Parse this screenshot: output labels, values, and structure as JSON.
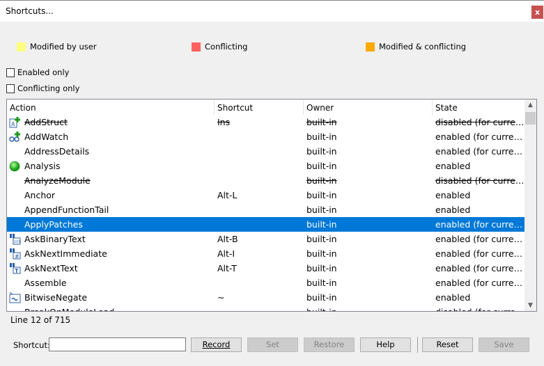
{
  "window": {
    "title": "Shortcuts...",
    "close": "x"
  },
  "legend": [
    {
      "label": "Modified by user",
      "color": "#ffff80"
    },
    {
      "label": "Conflicting",
      "color": "#ff6060"
    },
    {
      "label": "Modified & conflicting",
      "color": "#ffaa00"
    }
  ],
  "filters": {
    "enabled_only": {
      "label": "Enabled only",
      "checked": false
    },
    "conflicting_only": {
      "label": "Conflicting only",
      "checked": false
    }
  },
  "table": {
    "columns": [
      "Action",
      "Shortcut",
      "Owner",
      "State"
    ],
    "rows": [
      {
        "action": "AddStruct",
        "shortcut": "Ins",
        "owner": "built-in",
        "state": "disabled (for curren...",
        "icon": "add-struct-icon",
        "disabled": true
      },
      {
        "action": "AddWatch",
        "shortcut": "",
        "owner": "built-in",
        "state": "enabled (for current...",
        "icon": "add-watch-icon",
        "disabled": false
      },
      {
        "action": "AddressDetails",
        "shortcut": "",
        "owner": "built-in",
        "state": "enabled (for current...",
        "icon": "",
        "disabled": false
      },
      {
        "action": "Analysis",
        "shortcut": "",
        "owner": "built-in",
        "state": "enabled",
        "icon": "green-circle-icon",
        "disabled": false
      },
      {
        "action": "AnalyzeModule",
        "shortcut": "",
        "owner": "built-in",
        "state": "disabled (for curren...",
        "icon": "",
        "disabled": true
      },
      {
        "action": "Anchor",
        "shortcut": "Alt-L",
        "owner": "built-in",
        "state": "enabled",
        "icon": "",
        "disabled": false
      },
      {
        "action": "AppendFunctionTail",
        "shortcut": "",
        "owner": "built-in",
        "state": "enabled",
        "icon": "",
        "disabled": false
      },
      {
        "action": "ApplyPatches",
        "shortcut": "",
        "owner": "built-in",
        "state": "enabled (for current...",
        "icon": "",
        "disabled": false,
        "selected": true
      },
      {
        "action": "AskBinaryText",
        "shortcut": "Alt-B",
        "owner": "built-in",
        "state": "enabled (for current...",
        "icon": "binoculars-binary-icon",
        "disabled": false
      },
      {
        "action": "AskNextImmediate",
        "shortcut": "Alt-I",
        "owner": "built-in",
        "state": "enabled (for current...",
        "icon": "binoculars-hash-icon",
        "disabled": false
      },
      {
        "action": "AskNextText",
        "shortcut": "Alt-T",
        "owner": "built-in",
        "state": "enabled (for current...",
        "icon": "binoculars-text-icon",
        "disabled": false
      },
      {
        "action": "Assemble",
        "shortcut": "",
        "owner": "built-in",
        "state": "enabled (for current...",
        "icon": "",
        "disabled": false
      },
      {
        "action": "BitwiseNegate",
        "shortcut": "~",
        "owner": "built-in",
        "state": "enabled",
        "icon": "bitwise-negate-icon",
        "disabled": false
      },
      {
        "action": "BreakOnModuleLoad",
        "shortcut": "",
        "owner": "built-in",
        "state": "disabled (for curren...",
        "icon": "",
        "disabled": true
      }
    ]
  },
  "status": "Line 12 of 715",
  "footer": {
    "shortcut_label": "Shortcut:",
    "shortcut_value": "",
    "record": "Record",
    "set": "Set",
    "restore": "Restore",
    "help": "Help",
    "reset": "Reset",
    "save": "Save"
  },
  "colors": {
    "selection": "#0078d7"
  }
}
